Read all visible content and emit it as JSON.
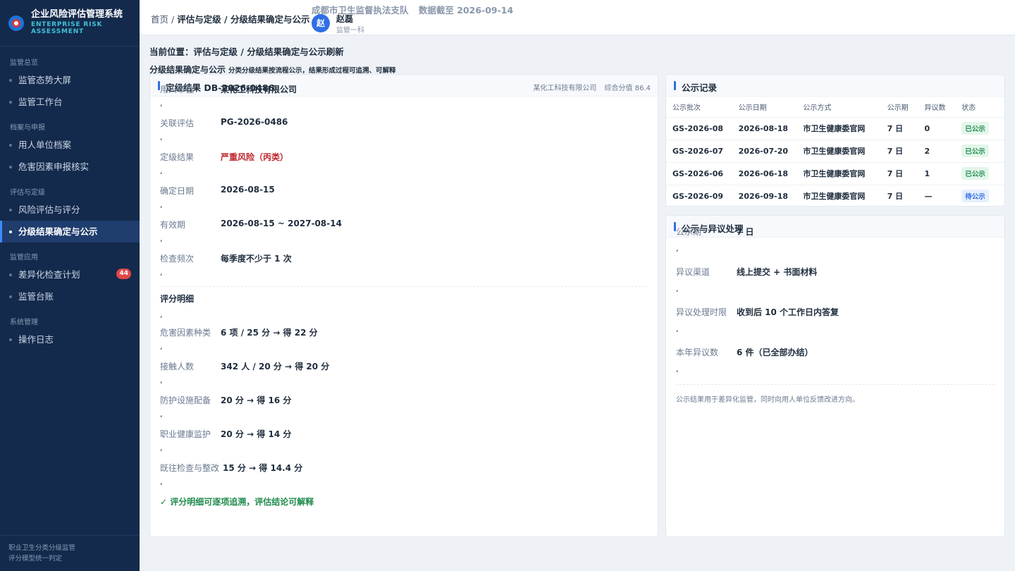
{
  "sidebar": {
    "title": "企业风险评估管理系统",
    "subtitle_line1": "ENTERPRISE RISK",
    "subtitle_line2": "ASSESSMENT",
    "groups": [
      {
        "label": "监管总览",
        "items": [
          {
            "label": "监管态势大屏"
          },
          {
            "label": "监管工作台"
          }
        ]
      },
      {
        "label": "档案与申报",
        "items": [
          {
            "label": "用人单位档案"
          },
          {
            "label": "危害因素申报核实"
          }
        ]
      },
      {
        "label": "评估与定级",
        "items": [
          {
            "label": "风险评估与评分"
          },
          {
            "label": "分级结果确定与公示",
            "active": true
          }
        ]
      },
      {
        "label": "监管应用",
        "items": [
          {
            "label": "差异化检查计划",
            "badge": "44"
          },
          {
            "label": "监管台账"
          }
        ]
      },
      {
        "label": "系统管理",
        "items": [
          {
            "label": "操作日志"
          }
        ]
      }
    ],
    "footer_line1": "职业卫生分类分级监管",
    "footer_line2": "评分模型统一判定"
  },
  "topbar": {
    "crumb_home": "首页",
    "crumb_sep": "/",
    "crumb_rest": "评估与定级 / 分级结果确定与公示",
    "org": "成都市卫生监督执法支队",
    "data_date": "数据截至 2026-09-14",
    "avatar": "赵",
    "user_name": "赵磊",
    "user_role": "监管一科"
  },
  "page": {
    "location": "当前位置：评估与定级 / 分级结果确定与公示刷新",
    "subtitle": "分级结果确定与公示",
    "subtitle_desc": "分类分级结果按流程公示，结果形成过程可追溯、可解释"
  },
  "grading": {
    "title": "定级结果 DB-2026-0486",
    "meta_company": "某化工科技有限公司",
    "meta_score": "综合分值 86.4",
    "fields": [
      {
        "k": "用人单位",
        "v": "某化工科技有限公司"
      },
      {
        "k": "关联评估",
        "v": "PG-2026-0486"
      },
      {
        "k": "定级结果",
        "v": "严重风险（丙类）",
        "danger": true
      },
      {
        "k": "确定日期",
        "v": "2026-08-15"
      },
      {
        "k": "有效期",
        "v": "2026-08-15 ~ 2027-08-14"
      },
      {
        "k": "检查频次",
        "v": "每季度不少于 1 次"
      }
    ],
    "detail_title": "评分明细",
    "details": [
      {
        "k": "危害因素种类",
        "v": "6 项 / 25 分 → 得 22 分"
      },
      {
        "k": "接触人数",
        "v": "342 人 / 20 分 → 得 20 分"
      },
      {
        "k": "防护设施配备",
        "v": "20 分 → 得 16 分"
      },
      {
        "k": "职业健康监护",
        "v": "20 分 → 得 14 分"
      },
      {
        "k": "既往检查与整改",
        "v": "15 分 → 得 14.4 分"
      }
    ],
    "comma": ",",
    "ok_note": "✓ 评分明细可逐项追溯，评估结论可解释"
  },
  "records": {
    "title": "公示记录",
    "columns": [
      "公示批次",
      "公示日期",
      "公示方式",
      "公示期",
      "异议数",
      "状态"
    ],
    "rows": [
      {
        "batch": "GS-2026-08",
        "date": "2026-08-18",
        "method": "市卫生健康委官网",
        "period": "7 日",
        "objections": "0",
        "status": "已公示",
        "status_type": "done"
      },
      {
        "batch": "GS-2026-07",
        "date": "2026-07-20",
        "method": "市卫生健康委官网",
        "period": "7 日",
        "objections": "2",
        "status": "已公示",
        "status_type": "done"
      },
      {
        "batch": "GS-2026-06",
        "date": "2026-06-18",
        "method": "市卫生健康委官网",
        "period": "7 日",
        "objections": "1",
        "status": "已公示",
        "status_type": "done"
      },
      {
        "batch": "GS-2026-09",
        "date": "2026-09-18",
        "method": "市卫生健康委官网",
        "period": "7 日",
        "objections": "—",
        "status": "待公示",
        "status_type": "pending"
      }
    ]
  },
  "objection": {
    "title": "公示与异议处理",
    "fields": [
      {
        "k": "公示期",
        "v": "7 日"
      },
      {
        "k": "异议渠道",
        "v": "线上提交 + 书面材料"
      },
      {
        "k": "异议处理时限",
        "v": "收到后 10 个工作日内答复"
      },
      {
        "k": "本年异议数",
        "v": "6 件（已全部办结）"
      }
    ],
    "note": "公示结果用于差异化监管，同时向用人单位反馈改进方向。"
  },
  "colors": {
    "accent": "#2f6fe4",
    "sidebar": "#142a4c",
    "danger": "#c0262b",
    "success": "#1f8a4c"
  }
}
